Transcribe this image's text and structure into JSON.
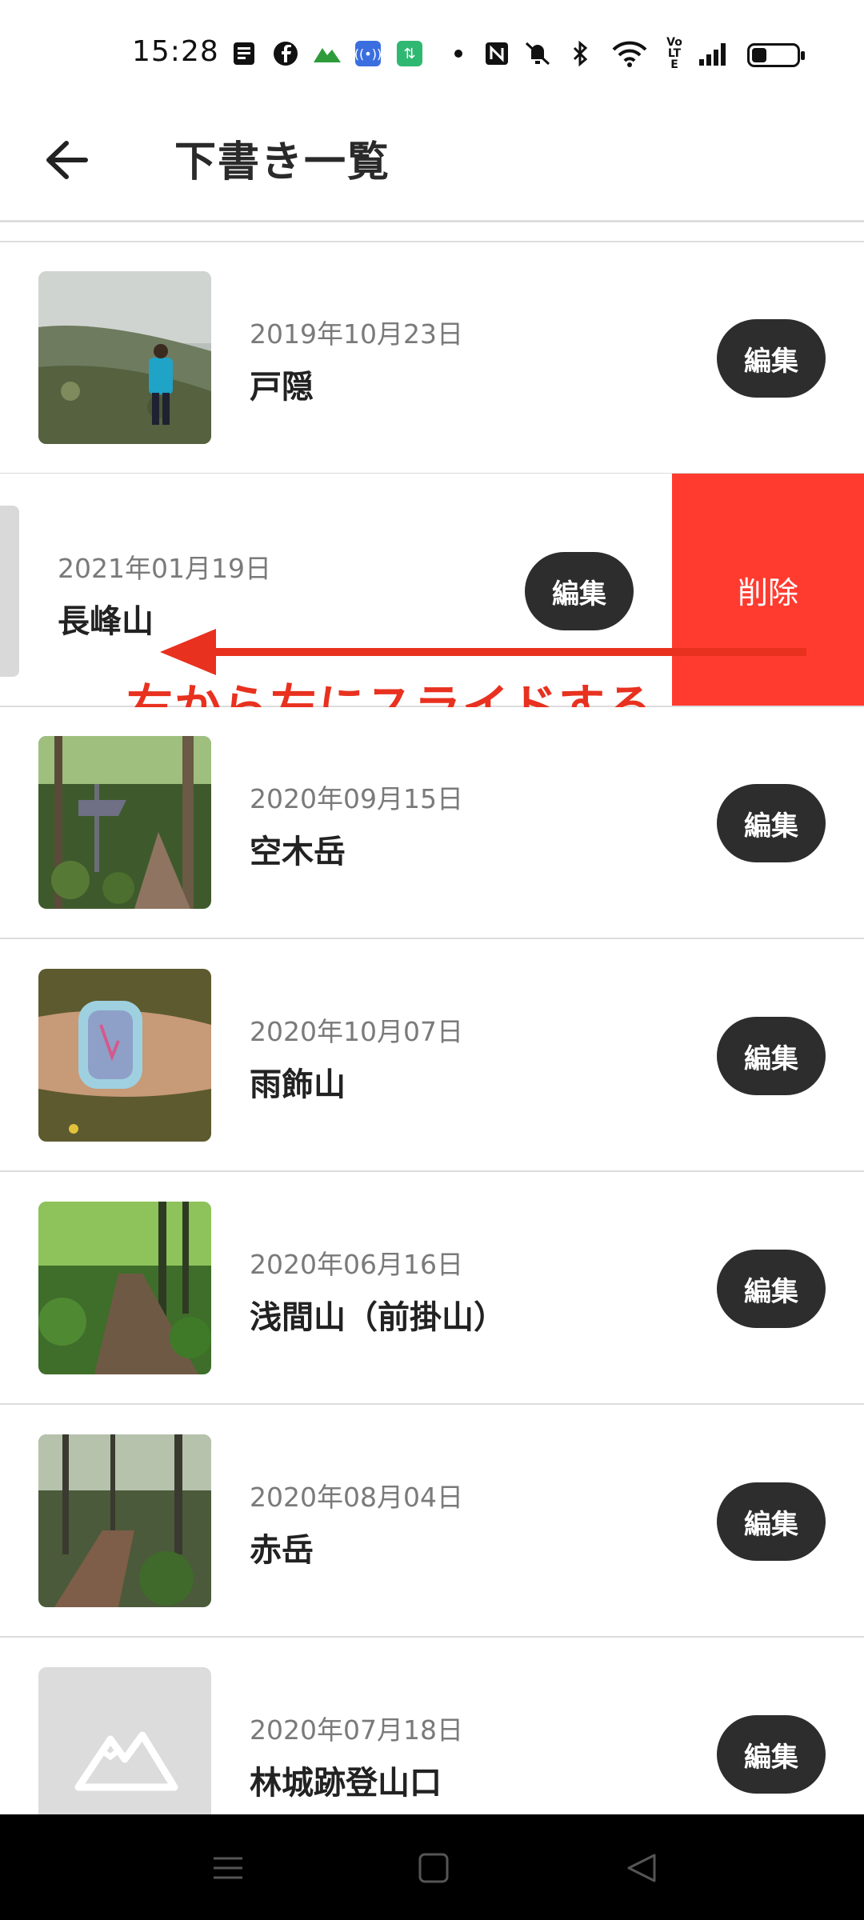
{
  "status_bar": {
    "time": "15:28",
    "icons": [
      "notes-icon",
      "facebook-icon",
      "mountain-app-icon",
      "nfc-broadcast-icon",
      "data-saver-icon",
      "dot-icon",
      "nfc-icon",
      "vibrate-off-icon",
      "bluetooth-icon",
      "wifi-icon",
      "volte-icon",
      "signal-icon",
      "battery-icon"
    ],
    "volte": "Vo LTE"
  },
  "app_bar": {
    "title": "下書き一覧",
    "back_icon": "arrow-left-icon"
  },
  "colors": {
    "accent_dark": "#2d2d2d",
    "delete_red": "#ff3b30",
    "annotation_red": "#e8311f",
    "divider": "#dcdcdc"
  },
  "drafts": [
    {
      "date": "2019年10月23日",
      "name": "戸隠",
      "edit_label": "編集",
      "thumb": "foggy-hillside-hiker-photo"
    },
    {
      "date": "2021年01月19日",
      "name": "長峰山",
      "edit_label": "編集",
      "delete_label": "削除",
      "swiped": true
    },
    {
      "date": "2020年09月15日",
      "name": "空木岳",
      "edit_label": "編集",
      "thumb": "forest-trail-sign-photo"
    },
    {
      "date": "2020年10月07日",
      "name": "雨飾山",
      "edit_label": "編集",
      "thumb": "smartwatch-wrist-photo"
    },
    {
      "date": "2020年06月16日",
      "name": "浅間山（前掛山）",
      "edit_label": "編集",
      "thumb": "green-forest-path-photo"
    },
    {
      "date": "2020年08月04日",
      "name": "赤岳",
      "edit_label": "編集",
      "thumb": "forest-trail-photo"
    },
    {
      "date": "2020年07月18日",
      "name": "林城跡登山口",
      "edit_label": "編集",
      "thumb": "mountain-placeholder-icon"
    }
  ],
  "annotation": {
    "text": "右から左にスライドする"
  },
  "nav_bar": {
    "buttons": [
      "menu-icon",
      "home-icon",
      "back-triangle-icon"
    ]
  }
}
